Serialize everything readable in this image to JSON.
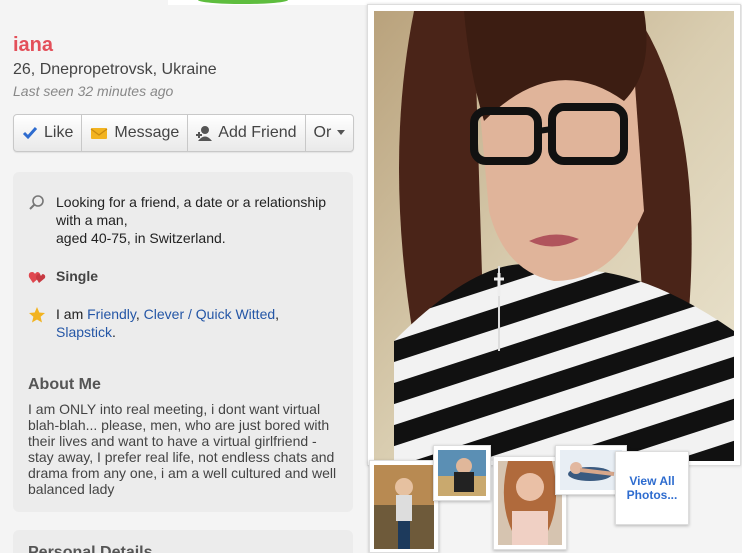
{
  "profile": {
    "name": "iana",
    "location": "26, Dnepropetrovsk, Ukraine",
    "last_seen": "Last seen 32 minutes ago"
  },
  "actions": {
    "like": "Like",
    "message": "Message",
    "add_friend": "Add Friend",
    "or": "Or"
  },
  "details": {
    "looking_for_line1": "Looking for a friend, a date or a relationship with a man,",
    "looking_for_line2": "aged 40-75, in Switzerland.",
    "status": "Single",
    "i_am_prefix": "I am ",
    "traits": [
      "Friendly",
      "Clever / Quick Witted",
      "Slapstick"
    ],
    "sep1": ", ",
    "sep2": ",",
    "end": "."
  },
  "about": {
    "heading": "About Me",
    "text": "I am ONLY into real meeting, i dont want virtual blah-blah... please, men, who are just bored with their lives and want to have a virtual girlfriend - stay away, I prefer real life, not endless chats and drama from any one, i am a well cultured and well balanced lady"
  },
  "personal_details": {
    "heading": "Personal Details"
  },
  "photos": {
    "view_all": "View All Photos..."
  },
  "colors": {
    "name": "#e3505a",
    "link": "#2456a6",
    "view_all": "#2e6ccf",
    "heart": "#e0474f",
    "star": "#f2b320"
  }
}
